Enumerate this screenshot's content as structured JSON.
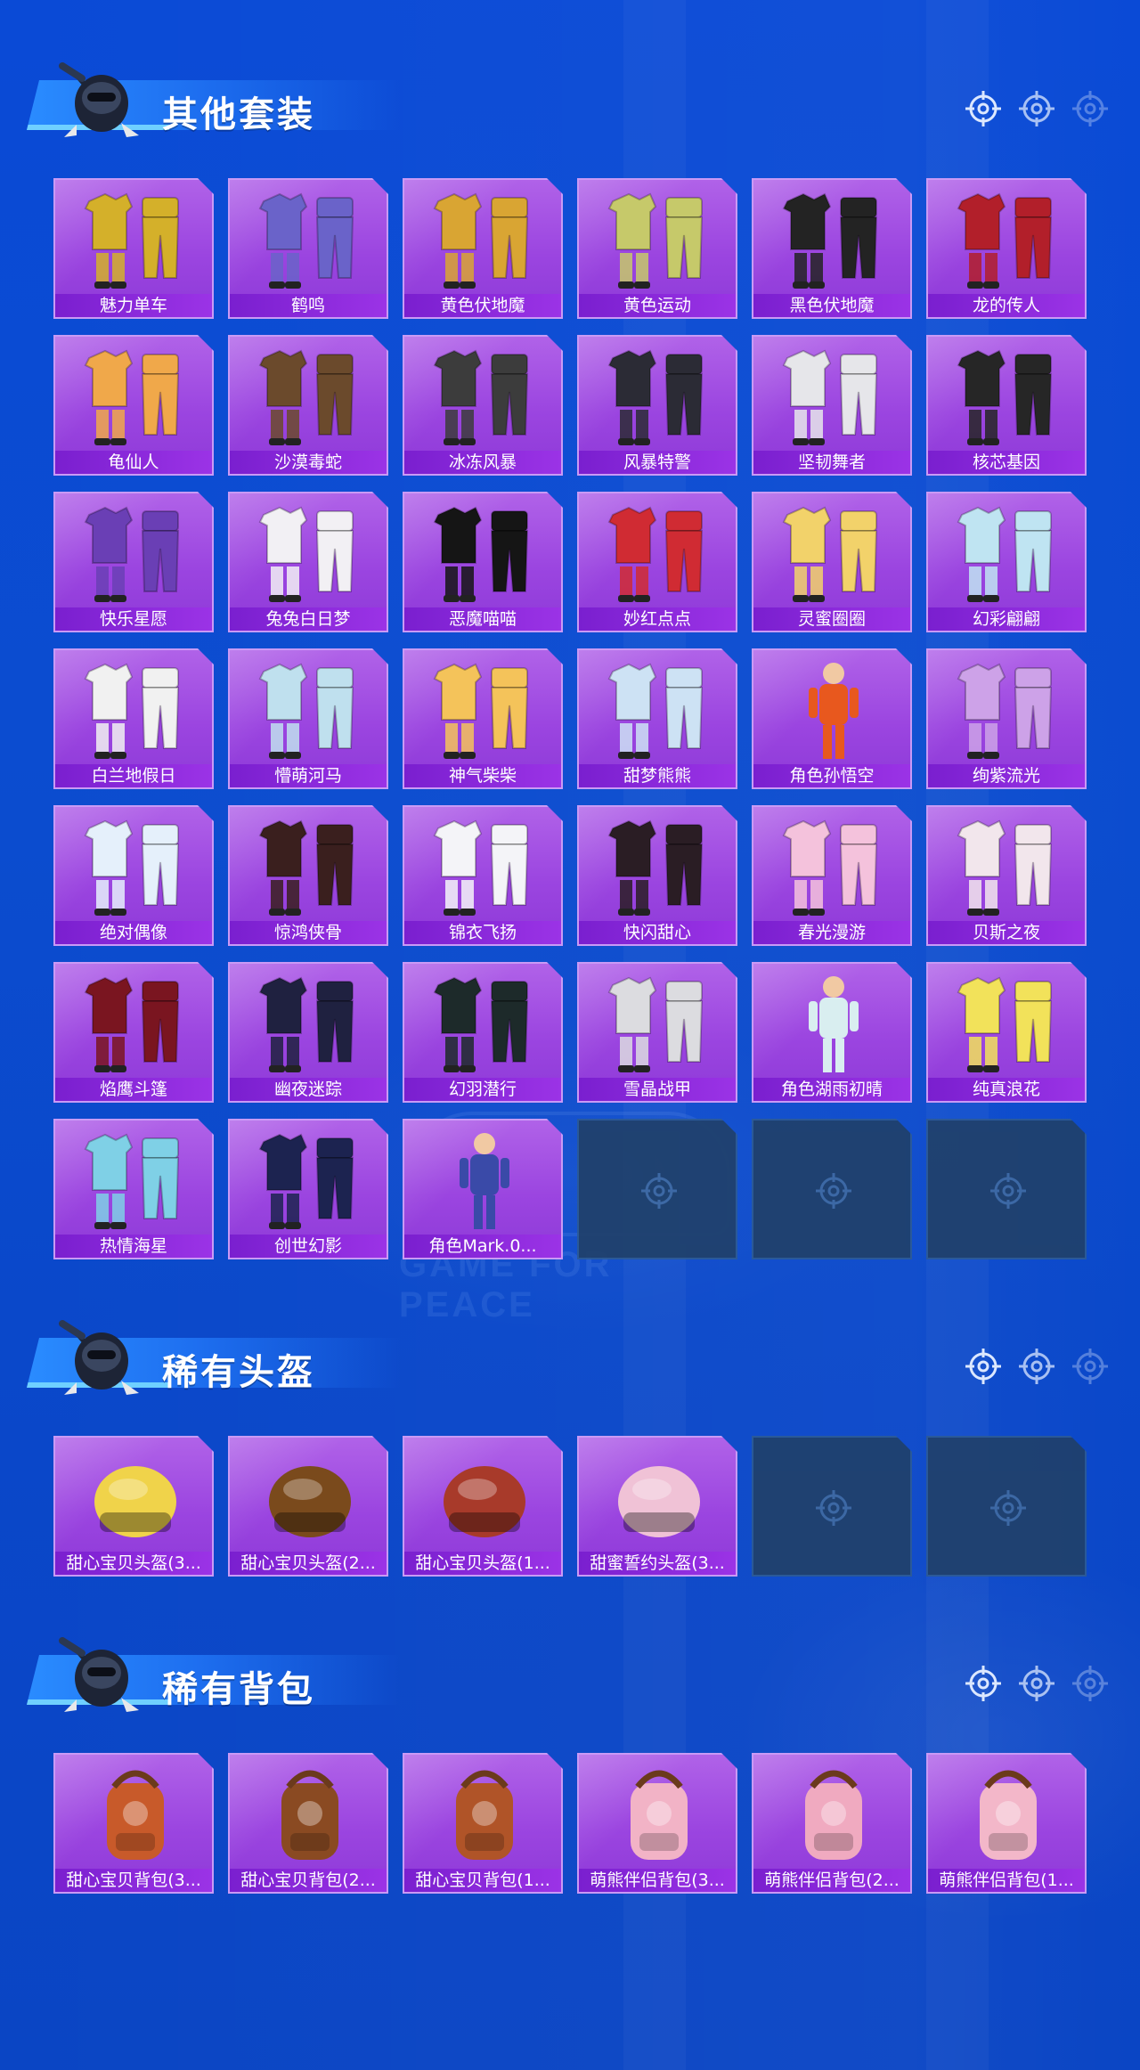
{
  "colors": {
    "background": "#0a4ad6",
    "tile_purple": "#9b45e0",
    "label_bar": "#7a1fcf",
    "empty_slot": "#20416d",
    "banner_blue": "#2a8cff"
  },
  "sections": [
    {
      "title": "其他套装",
      "items": [
        {
          "label": "魅力单车",
          "icon": "outfit-icon",
          "color": "#d4b02a"
        },
        {
          "label": "鹤鸣",
          "icon": "outfit-icon",
          "color": "#6a63c9"
        },
        {
          "label": "黄色伏地魔",
          "icon": "outfit-icon",
          "color": "#d9a533"
        },
        {
          "label": "黄色运动",
          "icon": "outfit-icon",
          "color": "#c6c96a"
        },
        {
          "label": "黑色伏地魔",
          "icon": "outfit-icon",
          "color": "#232323"
        },
        {
          "label": "龙的传人",
          "icon": "outfit-icon",
          "color": "#b21f2a"
        },
        {
          "label": "龟仙人",
          "icon": "outfit-icon",
          "color": "#f0a84a"
        },
        {
          "label": "沙漠毒蛇",
          "icon": "outfit-icon",
          "color": "#6b4a2c"
        },
        {
          "label": "冰冻风暴",
          "icon": "outfit-icon",
          "color": "#3c3c3c"
        },
        {
          "label": "风暴特警",
          "icon": "outfit-icon",
          "color": "#2b2b35"
        },
        {
          "label": "坚韧舞者",
          "icon": "outfit-icon",
          "color": "#e6e6ea"
        },
        {
          "label": "核芯基因",
          "icon": "outfit-icon",
          "color": "#262626"
        },
        {
          "label": "快乐星愿",
          "icon": "outfit-icon",
          "color": "#6a3fb5"
        },
        {
          "label": "兔兔白日梦",
          "icon": "outfit-icon",
          "color": "#f2f0f4"
        },
        {
          "label": "恶魔喵喵",
          "icon": "outfit-icon",
          "color": "#151515"
        },
        {
          "label": "妙红点点",
          "icon": "outfit-icon",
          "color": "#d02b33"
        },
        {
          "label": "灵蜜圈圈",
          "icon": "outfit-icon",
          "color": "#f2d26a"
        },
        {
          "label": "幻彩翩翩",
          "icon": "outfit-icon",
          "color": "#bfe4f2"
        },
        {
          "label": "白兰地假日",
          "icon": "outfit-icon",
          "color": "#f1f1f1"
        },
        {
          "label": "懵萌河马",
          "icon": "outfit-icon",
          "color": "#bfe0ee"
        },
        {
          "label": "神气柴柴",
          "icon": "outfit-icon",
          "color": "#f4c35a"
        },
        {
          "label": "甜梦熊熊",
          "icon": "outfit-icon",
          "color": "#cde2f4"
        },
        {
          "label": "角色孙悟空",
          "icon": "character-icon",
          "color": "#e8581e"
        },
        {
          "label": "绚紫流光",
          "icon": "outfit-icon",
          "color": "#cda2e8"
        },
        {
          "label": "绝对偶像",
          "icon": "outfit-icon",
          "color": "#e5f0fb"
        },
        {
          "label": "惊鸿侠骨",
          "icon": "outfit-icon",
          "color": "#3a1f1e"
        },
        {
          "label": "锦衣飞扬",
          "icon": "outfit-icon",
          "color": "#f4f4f8"
        },
        {
          "label": "快闪甜心",
          "icon": "outfit-icon",
          "color": "#2a1d24"
        },
        {
          "label": "春光漫游",
          "icon": "outfit-icon",
          "color": "#f4c2dc"
        },
        {
          "label": "贝斯之夜",
          "icon": "outfit-icon",
          "color": "#f2e6ec"
        },
        {
          "label": "焰鹰斗篷",
          "icon": "outfit-icon",
          "color": "#7a1520"
        },
        {
          "label": "幽夜迷踪",
          "icon": "outfit-icon",
          "color": "#1f2140"
        },
        {
          "label": "幻羽潜行",
          "icon": "outfit-icon",
          "color": "#1d2a2a"
        },
        {
          "label": "雪晶战甲",
          "icon": "outfit-icon",
          "color": "#dcdce0"
        },
        {
          "label": "角色湖雨初晴",
          "icon": "character-icon",
          "color": "#d9eef0"
        },
        {
          "label": "纯真浪花",
          "icon": "outfit-icon",
          "color": "#f2e25a"
        },
        {
          "label": "热情海星",
          "icon": "outfit-icon",
          "color": "#7fd0e6"
        },
        {
          "label": "创世幻影",
          "icon": "outfit-icon",
          "color": "#1c2350"
        },
        {
          "label": "角色Mark.0...",
          "icon": "character-icon",
          "color": "#3a4aa8"
        }
      ],
      "empty_slots": 3
    },
    {
      "title": "稀有头盔",
      "items": [
        {
          "label": "甜心宝贝头盔(3...",
          "icon": "helmet-icon",
          "color": "#f0d34a"
        },
        {
          "label": "甜心宝贝头盔(2...",
          "icon": "helmet-icon",
          "color": "#7a4a1c"
        },
        {
          "label": "甜心宝贝头盔(1...",
          "icon": "helmet-icon",
          "color": "#a83a2a"
        },
        {
          "label": "甜蜜誓约头盔(3...",
          "icon": "helmet-icon",
          "color": "#f0c2d6"
        }
      ],
      "empty_slots": 2
    },
    {
      "title": "稀有背包",
      "items": [
        {
          "label": "甜心宝贝背包(3...",
          "icon": "backpack-icon",
          "color": "#c85a2a"
        },
        {
          "label": "甜心宝贝背包(2...",
          "icon": "backpack-icon",
          "color": "#8a4a22"
        },
        {
          "label": "甜心宝贝背包(1...",
          "icon": "backpack-icon",
          "color": "#b05428"
        },
        {
          "label": "萌熊伴侣背包(3...",
          "icon": "backpack-icon",
          "color": "#f2b3c6"
        },
        {
          "label": "萌熊伴侣背包(2...",
          "icon": "backpack-icon",
          "color": "#f0aac0"
        },
        {
          "label": "萌熊伴侣背包(1...",
          "icon": "backpack-icon",
          "color": "#f3b7c9"
        }
      ],
      "empty_slots": 0
    }
  ]
}
